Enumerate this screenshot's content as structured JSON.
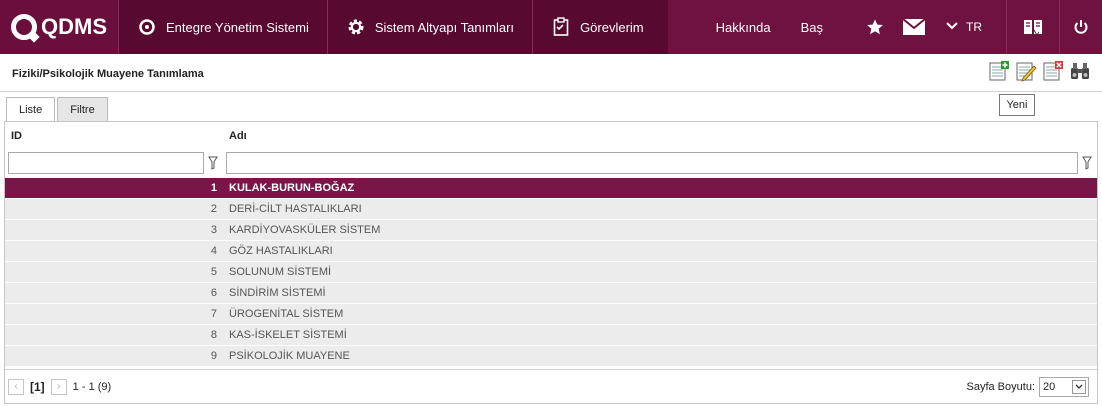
{
  "app": {
    "logo_text": "QDMS"
  },
  "nav": {
    "items": [
      {
        "label": "Entegre Yönetim Sistemi",
        "icon": "q-circle-icon"
      },
      {
        "label": "Sistem Altyapı Tanımları",
        "icon": "gear-icon"
      },
      {
        "label": "Görevlerim",
        "icon": "tasks-icon"
      }
    ],
    "about": "Hakkında",
    "start": "Baş",
    "language": "TR"
  },
  "page": {
    "title": "Fiziki/Psikolojik Muayene Tanımlama"
  },
  "toolbar": {
    "tooltip": "Yeni"
  },
  "tabs": [
    {
      "label": "Liste",
      "active": true
    },
    {
      "label": "Filtre",
      "active": false
    }
  ],
  "grid": {
    "columns": [
      "ID",
      "Adı"
    ],
    "rows": [
      {
        "id": "1",
        "name": "KULAK-BURUN-BOĞAZ"
      },
      {
        "id": "2",
        "name": "DERİ-CİLT HASTALIKLARI"
      },
      {
        "id": "3",
        "name": "KARDİYOVASKÜLER SİSTEM"
      },
      {
        "id": "4",
        "name": "GÖZ HASTALIKLARI"
      },
      {
        "id": "5",
        "name": "SOLUNUM SİSTEMİ"
      },
      {
        "id": "6",
        "name": "SİNDİRİM SİSTEMİ"
      },
      {
        "id": "7",
        "name": "ÜROGENİTAL SİSTEM"
      },
      {
        "id": "8",
        "name": "KAS-İSKELET SİSTEMİ"
      },
      {
        "id": "9",
        "name": "PSİKOLOJİK MUAYENE"
      }
    ],
    "selected_index": 0
  },
  "pager": {
    "current_page": "[1]",
    "info": "1 - 1 (9)",
    "page_size_label": "Sayfa Boyutu:",
    "page_size": "20"
  },
  "colors": {
    "brand": "#6e1240",
    "selected_row": "#7a1548"
  }
}
